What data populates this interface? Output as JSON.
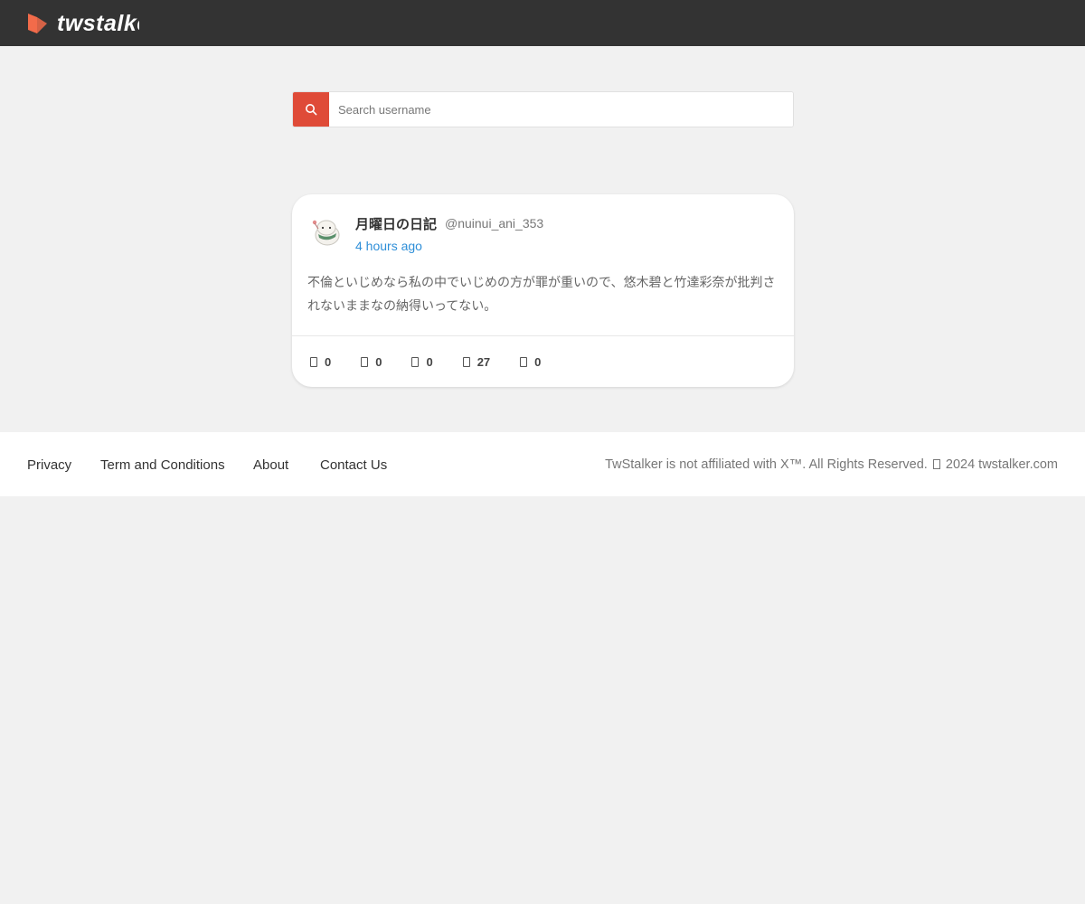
{
  "header": {
    "logo_text": "twstalker",
    "brand_color": "#f26b4a"
  },
  "search": {
    "placeholder": "Search username",
    "button_icon": "search-icon",
    "button_color": "#df4b38"
  },
  "post": {
    "display_name": "月曜日の日記",
    "handle": "@nuinui_ani_353",
    "time": "4 hours ago",
    "text": "不倫といじめなら私の中でいじめの方が罪が重いので、悠木碧と竹達彩奈が批判されないままなの納得いってない。",
    "actions": [
      {
        "icon": "reply-icon",
        "count": "0"
      },
      {
        "icon": "retweet-icon",
        "count": "0"
      },
      {
        "icon": "quote-icon",
        "count": "0"
      },
      {
        "icon": "like-icon",
        "count": "27"
      },
      {
        "icon": "view-icon",
        "count": "0"
      }
    ]
  },
  "footer": {
    "links": [
      "Privacy",
      "Term and Conditions",
      "About",
      "Contact Us"
    ],
    "copyright_prefix": "TwStalker is not affiliated with X™. All Rights Reserved.",
    "copyright_suffix": "2024 twstalker.com"
  }
}
